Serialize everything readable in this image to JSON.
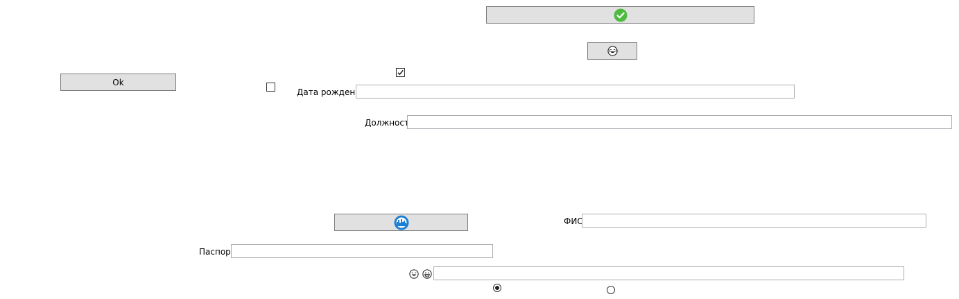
{
  "buttons": {
    "ok_label": "Ok"
  },
  "icons": {
    "confirm_top": "check-circle-icon",
    "emoji_button": "laughing-emoji-icon",
    "middle_button": "blue-circle-skyline-icon",
    "emoji_laugh": "laughing-emoji-icon",
    "emoji_grin": "grinning-emoji-icon"
  },
  "fields": {
    "birth_date": {
      "label": "Дата рождения",
      "value": ""
    },
    "position": {
      "label": "Должность",
      "value": ""
    },
    "full_name": {
      "label": "ФИО",
      "value": ""
    },
    "passport": {
      "label": "Паспорт",
      "value": ""
    },
    "emoji_field": {
      "value": ""
    }
  },
  "checkboxes": {
    "top_checked": true,
    "left_checked": false
  },
  "radios": {
    "left_selected": true,
    "right_selected": false
  },
  "colors": {
    "button_bg": "#e1e1e1",
    "button_border": "#7a7a7a",
    "field_border": "#abadb3",
    "confirm_green": "#4cbb3f",
    "icon_blue": "#1a7fd6"
  }
}
